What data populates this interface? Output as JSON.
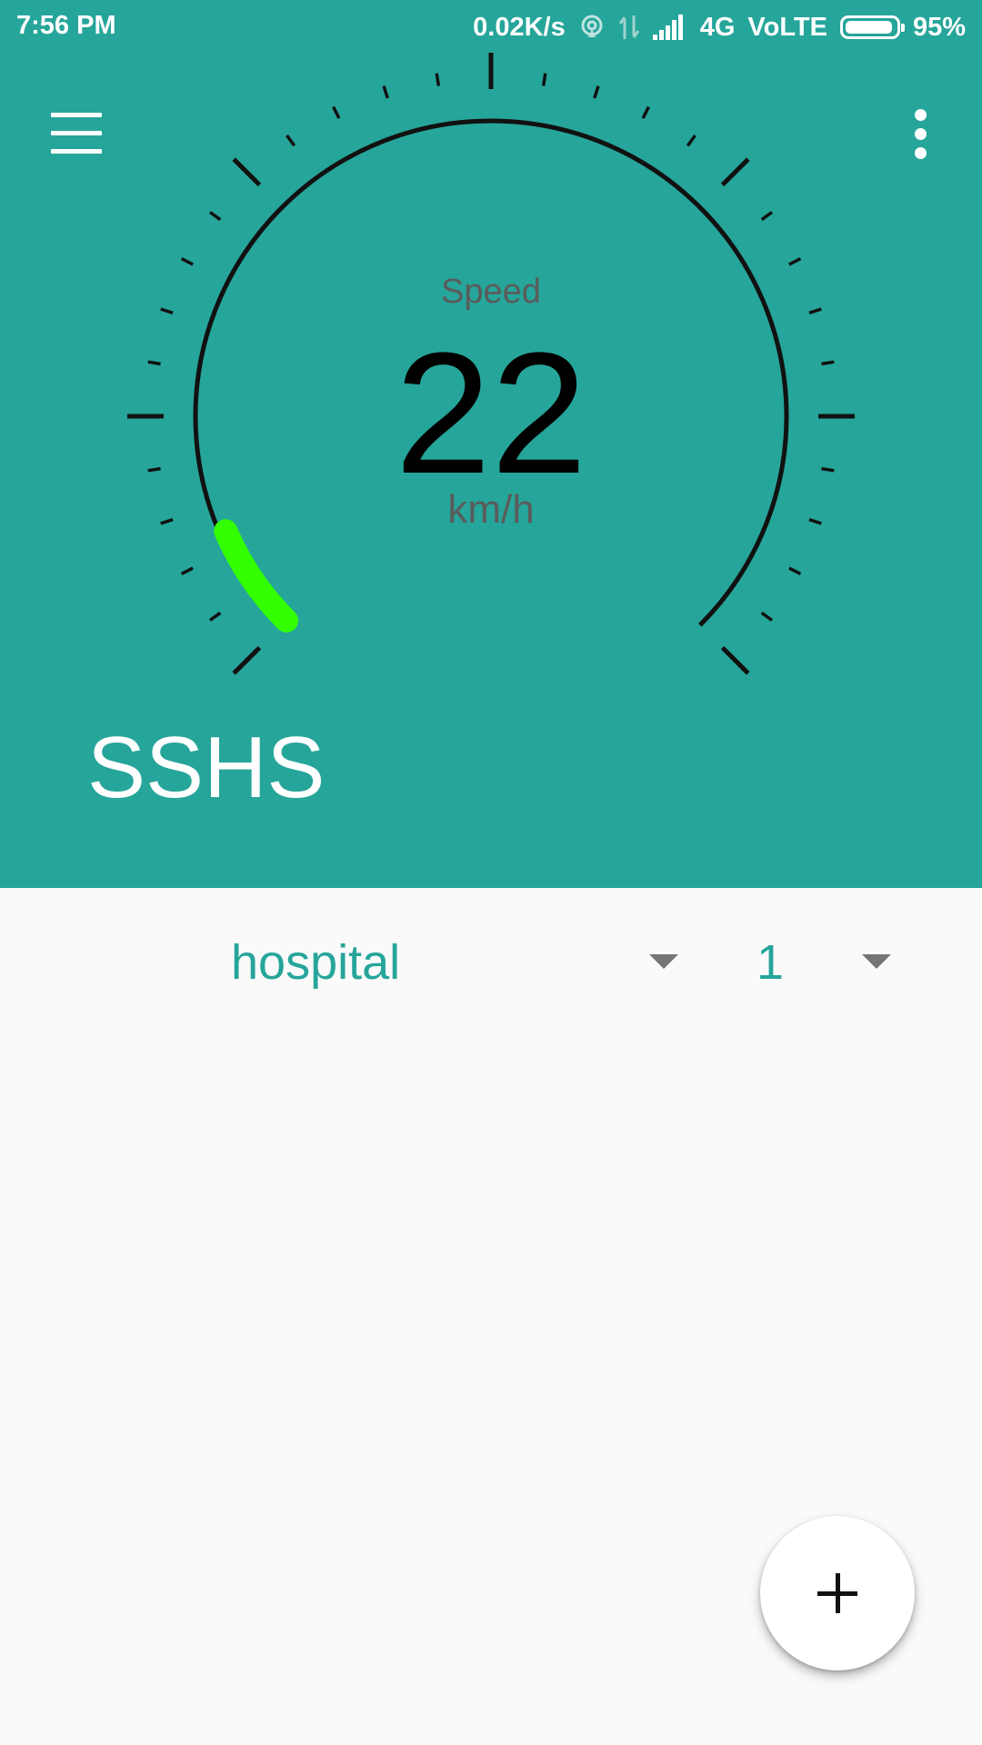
{
  "status_bar": {
    "time": "7:56 PM",
    "net_speed": "0.02K/s",
    "network_type": "4G",
    "volte": "VoLTE",
    "battery_percent": "95%",
    "battery_level": 0.95
  },
  "toolbar": {
    "menu_icon": "hamburger-menu-icon",
    "more_icon": "more-vert-icon"
  },
  "speedometer": {
    "label": "Speed",
    "value": "22",
    "unit": "km/h",
    "progress_color": "#33ff00",
    "needle_fraction": 0.08
  },
  "app": {
    "name": "SSHS"
  },
  "selectors": {
    "place": "hospital",
    "count": "1"
  },
  "fab": {
    "icon": "add-icon"
  },
  "colors": {
    "primary": "#26a59a",
    "background": "#fafafa",
    "text_gray": "#5b5b5b"
  }
}
